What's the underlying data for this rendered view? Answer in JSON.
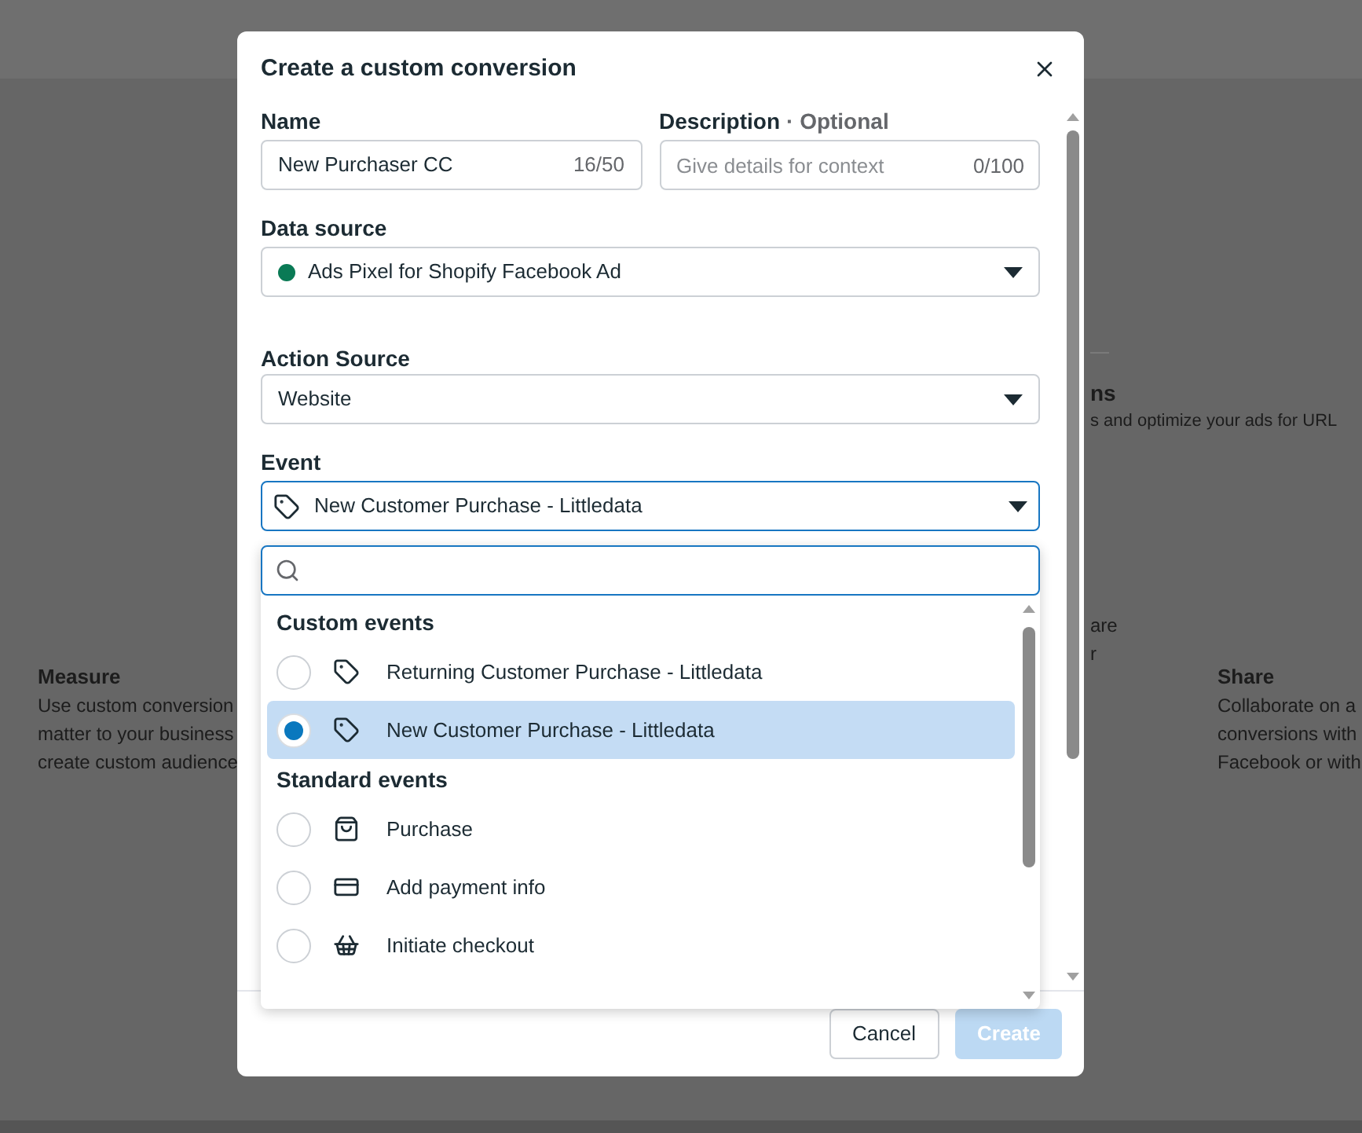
{
  "background": {
    "header_fragment": "ns",
    "subtitle_fragment": "s and optimize your ads for URL",
    "columns": [
      {
        "title": "Measure",
        "lines": [
          "Use custom conversion",
          "matter to your business",
          "create custom audience"
        ]
      },
      {
        "lines": [
          "are",
          "r"
        ]
      },
      {
        "title": "Share",
        "lines": [
          "Collaborate on a",
          "conversions with",
          "Facebook or with"
        ]
      }
    ]
  },
  "dialog": {
    "title": "Create a custom conversion",
    "name_field": {
      "label": "Name",
      "value": "New Purchaser CC",
      "counter": "16/50"
    },
    "description_field": {
      "label": "Description",
      "label_note": "· Optional",
      "placeholder": "Give details for context",
      "counter": "0/100"
    },
    "data_source": {
      "label": "Data source",
      "value": "Ads Pixel for Shopify Facebook Ad"
    },
    "action_source": {
      "label": "Action Source",
      "value": "Website"
    },
    "event": {
      "label": "Event",
      "value": "New Customer Purchase - Littledata",
      "expanded": true
    },
    "event_menu": {
      "groups": [
        {
          "heading": "Custom events",
          "items": [
            {
              "label": "Returning Customer Purchase - Littledata",
              "kind": "tag",
              "selected": false
            },
            {
              "label": "New Customer Purchase - Littledata",
              "kind": "tag",
              "selected": true
            }
          ]
        },
        {
          "heading": "Standard events",
          "items": [
            {
              "label": "Purchase",
              "kind": "bag",
              "selected": false
            },
            {
              "label": "Add payment info",
              "kind": "card",
              "selected": false
            },
            {
              "label": "Initiate checkout",
              "kind": "basket",
              "selected": false
            }
          ]
        }
      ]
    },
    "buttons": {
      "cancel": {
        "label": "Cancel"
      },
      "create": {
        "label": "Create",
        "disabled": true
      }
    }
  }
}
